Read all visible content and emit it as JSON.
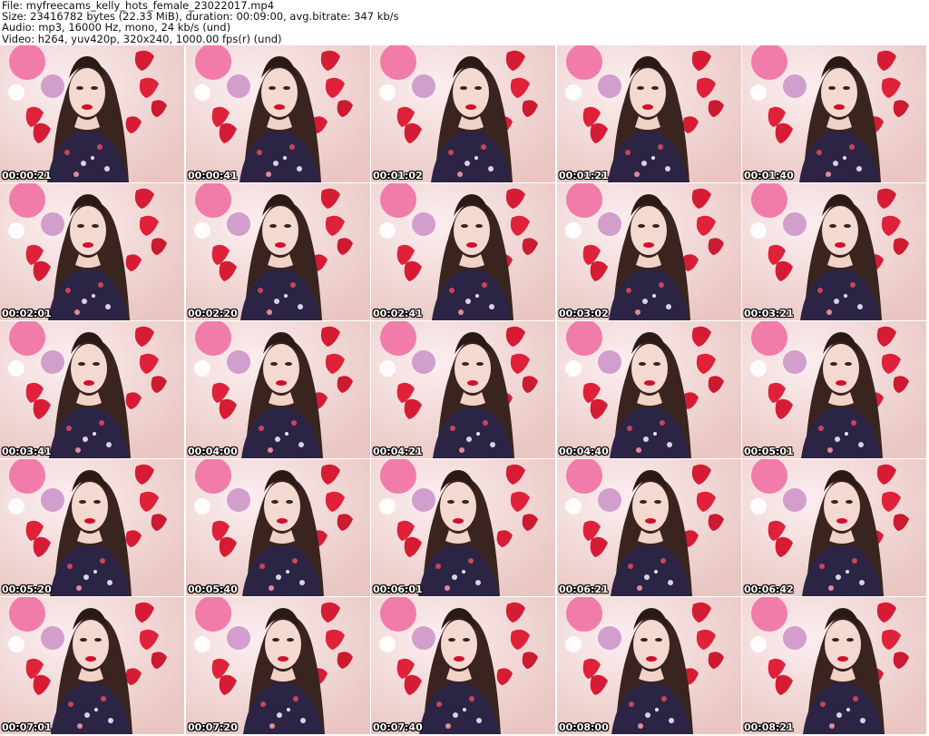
{
  "header": {
    "file_line": "File: myfreecams_kelly_hots_female_23022017.mp4",
    "size_line": "Size: 23416782 bytes (22.33 MiB), duration: 00:09:00, avg.bitrate: 347 kb/s",
    "audio_line": "Audio: mp3, 16000 Hz, mono, 24 kb/s (und)",
    "video_line": "Video: h264, yuv420p, 320x240, 1000.00 fps(r) (und)"
  },
  "thumbnails": [
    {
      "timestamp": "00:00:21"
    },
    {
      "timestamp": "00:00:41"
    },
    {
      "timestamp": "00:01:02"
    },
    {
      "timestamp": "00:01:21"
    },
    {
      "timestamp": "00:01:40"
    },
    {
      "timestamp": "00:02:01"
    },
    {
      "timestamp": "00:02:20"
    },
    {
      "timestamp": "00:02:41"
    },
    {
      "timestamp": "00:03:02"
    },
    {
      "timestamp": "00:03:21"
    },
    {
      "timestamp": "00:03:41"
    },
    {
      "timestamp": "00:04:00"
    },
    {
      "timestamp": "00:04:21"
    },
    {
      "timestamp": "00:04:40"
    },
    {
      "timestamp": "00:05:01"
    },
    {
      "timestamp": "00:05:20"
    },
    {
      "timestamp": "00:05:40"
    },
    {
      "timestamp": "00:06:01"
    },
    {
      "timestamp": "00:06:21"
    },
    {
      "timestamp": "00:06:42"
    },
    {
      "timestamp": "00:07:01"
    },
    {
      "timestamp": "00:07:20"
    },
    {
      "timestamp": "00:07:40"
    },
    {
      "timestamp": "00:08:00"
    },
    {
      "timestamp": "00:08:21"
    }
  ]
}
